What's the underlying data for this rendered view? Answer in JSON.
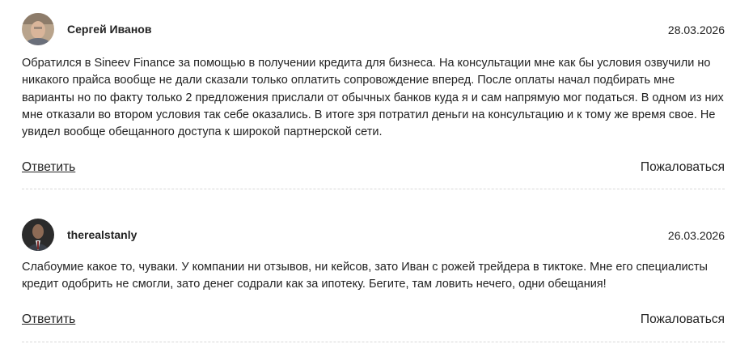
{
  "reviews": [
    {
      "author": "Сергей Иванов",
      "date": "28.03.2026",
      "text": "Обратился в Sineev Finance за помощью в получении кредита для бизнеса. На консультации мне как бы условия озвучили но никакого прайса вообще не дали сказали только оплатить сопровождение вперед. После оплаты начал подбирать мне варианты но по факту только 2 предложения прислали от обычных банков куда я и сам напрямую мог податься. В одном из них мне отказали во втором условия так себе оказались. В итоге зря потратил деньги на консультацию и к тому же время свое. Не увидел вообще обещанного доступа к широкой партнерской сети.",
      "reply_label": "Ответить",
      "report_label": "Пожаловаться"
    },
    {
      "author": "therealstanly",
      "date": "26.03.2026",
      "text": "Слабоумие какое то, чуваки. У компании ни отзывов, ни кейсов, зато Иван с рожей трейдера в тиктоке. Мне его специалисты кредит одобрить не смогли, зато денег содрали как за ипотеку. Бегите, там ловить нечего, одни обещания!",
      "reply_label": "Ответить",
      "report_label": "Пожаловаться"
    }
  ]
}
